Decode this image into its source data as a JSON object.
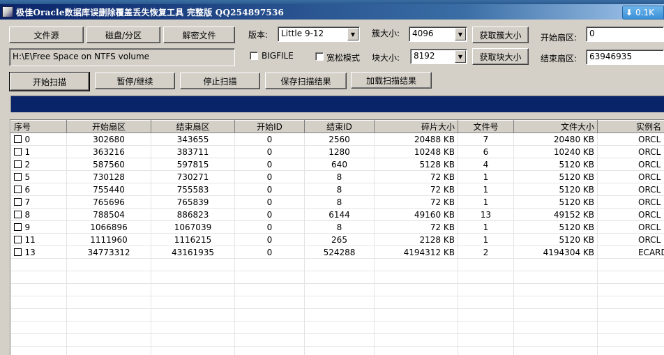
{
  "window": {
    "title": "极佳Oracle数据库误删除覆盖丢失恢复工具 完整版 QQ254897536",
    "net_speed": "0.1K"
  },
  "toolbar": {
    "file_source": "文件源",
    "disk_partition": "磁盘/分区",
    "decrypt_file": "解密文件",
    "start_scan": "开始扫描",
    "pause_resume": "暂停/继续",
    "stop_scan": "停止扫描",
    "save_results": "保存扫描结果",
    "load_results": "加载扫描结果"
  },
  "source_path": "H:\\E\\Free Space on NTFS volume",
  "settings": {
    "version_label": "版本:",
    "version_value": "Little 9-12",
    "bigfile_label": "BIGFILE",
    "loose_mode_label": "宽松模式",
    "cluster_size_label": "簇大小:",
    "cluster_size_value": "4096",
    "block_size_label": "块大小:",
    "block_size_value": "8192",
    "get_cluster_btn": "获取簇大小",
    "get_block_btn": "获取块大小",
    "start_sector_label": "开始扇区:",
    "start_sector_value": "0",
    "end_sector_label": "结束扇区:",
    "end_sector_value": "63946935"
  },
  "progress": {
    "fraction": 1.0
  },
  "table": {
    "columns": [
      "序号",
      "开始扇区",
      "结束扇区",
      "开始ID",
      "结束ID",
      "碎片大小",
      "文件号",
      "文件大小",
      "实例名"
    ],
    "rows": [
      [
        "0",
        "302680",
        "343655",
        "0",
        "2560",
        "20488 KB",
        "7",
        "20480 KB",
        "ORCL"
      ],
      [
        "1",
        "363216",
        "383711",
        "0",
        "1280",
        "10248 KB",
        "6",
        "10240 KB",
        "ORCL"
      ],
      [
        "2",
        "587560",
        "597815",
        "0",
        "640",
        "5128 KB",
        "4",
        "5120 KB",
        "ORCL"
      ],
      [
        "5",
        "730128",
        "730271",
        "0",
        "8",
        "72 KB",
        "1",
        "5120 KB",
        "ORCL"
      ],
      [
        "6",
        "755440",
        "755583",
        "0",
        "8",
        "72 KB",
        "1",
        "5120 KB",
        "ORCL"
      ],
      [
        "7",
        "765696",
        "765839",
        "0",
        "8",
        "72 KB",
        "1",
        "5120 KB",
        "ORCL"
      ],
      [
        "8",
        "788504",
        "886823",
        "0",
        "6144",
        "49160 KB",
        "13",
        "49152 KB",
        "ORCL"
      ],
      [
        "9",
        "1066896",
        "1067039",
        "0",
        "8",
        "72 KB",
        "1",
        "5120 KB",
        "ORCL"
      ],
      [
        "11",
        "1111960",
        "1116215",
        "0",
        "265",
        "2128 KB",
        "1",
        "5120 KB",
        "ORCL"
      ],
      [
        "13",
        "34773312",
        "43161935",
        "0",
        "524288",
        "4194312 KB",
        "2",
        "4194304 KB",
        "ECARD"
      ]
    ]
  }
}
